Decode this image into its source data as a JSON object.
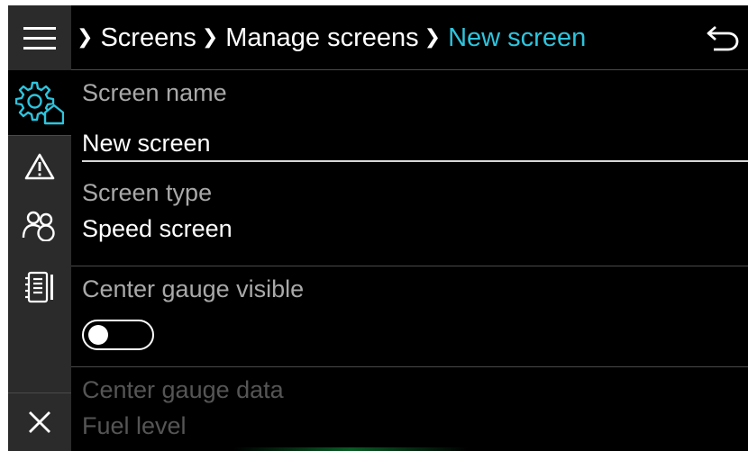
{
  "header": {
    "breadcrumb": [
      {
        "label": "Screens"
      },
      {
        "label": "Manage screens"
      },
      {
        "label": "New screen"
      }
    ]
  },
  "rail": {
    "items": [
      {
        "icon": "menu-icon"
      },
      {
        "icon": "settings-home-icon",
        "active": true
      },
      {
        "icon": "warning-icon"
      },
      {
        "icon": "users-icon"
      },
      {
        "icon": "notebook-icon"
      },
      {
        "icon": "close-icon"
      }
    ]
  },
  "fields": {
    "screen_name": {
      "label": "Screen name",
      "value": "New screen"
    },
    "screen_type": {
      "label": "Screen type",
      "value": "Speed screen"
    },
    "center_gauge_visible": {
      "label": "Center gauge visible",
      "on": false
    },
    "center_gauge_data": {
      "label": "Center gauge data",
      "value": "Fuel level",
      "enabled": false
    }
  },
  "colors": {
    "accent": "#2ec4dd",
    "rail_bg": "#2b2b2b",
    "background": "#000000",
    "label": "#a9a9a9",
    "disabled": "#555555"
  }
}
